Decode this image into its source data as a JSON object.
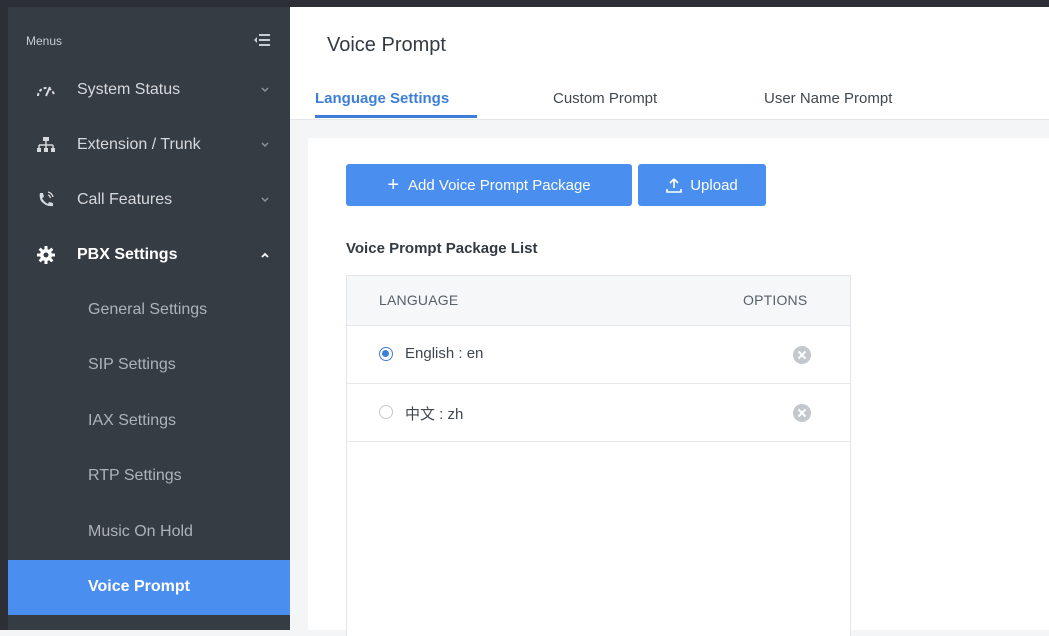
{
  "sidebar": {
    "menus_label": "Menus",
    "items": [
      {
        "label": "System Status",
        "icon": "gauge-icon",
        "expanded": false
      },
      {
        "label": "Extension / Trunk",
        "icon": "network-icon",
        "expanded": false
      },
      {
        "label": "Call Features",
        "icon": "phone-icon",
        "expanded": false
      },
      {
        "label": "PBX Settings",
        "icon": "gear-icon",
        "expanded": true
      }
    ],
    "sub_items": [
      {
        "label": "General Settings"
      },
      {
        "label": "SIP Settings"
      },
      {
        "label": "IAX Settings"
      },
      {
        "label": "RTP Settings"
      },
      {
        "label": "Music On Hold"
      },
      {
        "label": "Voice Prompt"
      }
    ],
    "active_sub_item": "Voice Prompt"
  },
  "header": {
    "title": "Voice Prompt",
    "tabs": [
      {
        "label": "Language Settings"
      },
      {
        "label": "Custom Prompt"
      },
      {
        "label": "User Name Prompt"
      }
    ],
    "active_tab": "Language Settings"
  },
  "toolbar": {
    "add_label": "Add Voice Prompt Package",
    "add_icon": "plus-icon",
    "upload_label": "Upload",
    "upload_icon": "upload-icon"
  },
  "list": {
    "title": "Voice Prompt Package List",
    "columns": [
      "LANGUAGE",
      "OPTIONS"
    ],
    "rows": [
      {
        "language": "English : en",
        "selected": true
      },
      {
        "language": "中文 : zh",
        "selected": false
      }
    ]
  },
  "colors": {
    "accent": "#4a8ef0",
    "sidebar_bg": "#363c43",
    "tab_active": "#3d7fd8"
  }
}
